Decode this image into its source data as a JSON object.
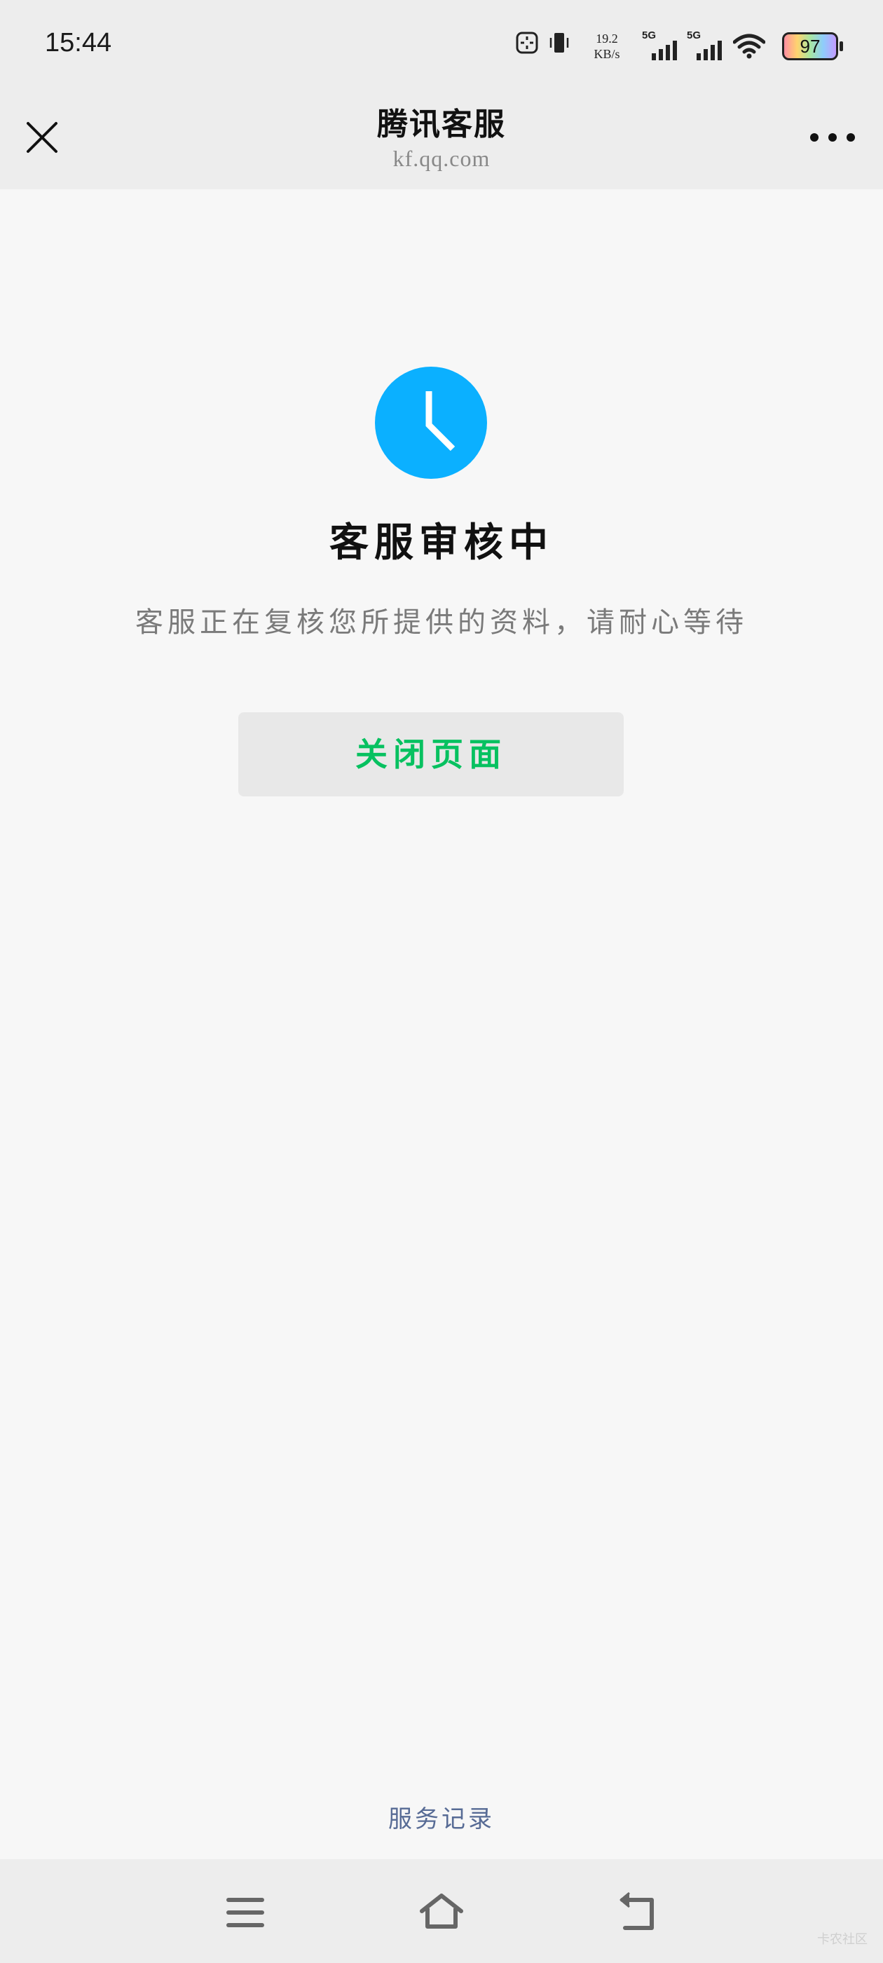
{
  "status_bar": {
    "time": "15:44",
    "net_speed_value": "19.2",
    "net_speed_unit": "KB/s",
    "sim1_label": "5G",
    "sim2_label": "5G",
    "battery_level": "97",
    "icons": [
      "screen-capture-icon",
      "vibrate-icon",
      "signal-icon",
      "signal-icon",
      "wifi-icon",
      "battery-icon"
    ]
  },
  "header": {
    "title": "腾讯客服",
    "url": "kf.qq.com",
    "close_icon": "close-icon",
    "more_icon": "more-icon"
  },
  "main": {
    "status_icon": "clock-icon",
    "accent_color": "#0bb0ff",
    "title": "客服审核中",
    "description": "客服正在复核您所提供的资料，请耐心等待",
    "close_button_label": "关闭页面",
    "button_text_color": "#07c160"
  },
  "footer": {
    "service_records_label": "服务记录",
    "link_color": "#576b95"
  },
  "system_nav": {
    "buttons": [
      "menu-icon",
      "home-icon",
      "back-icon"
    ]
  },
  "watermark": "卡农社区"
}
